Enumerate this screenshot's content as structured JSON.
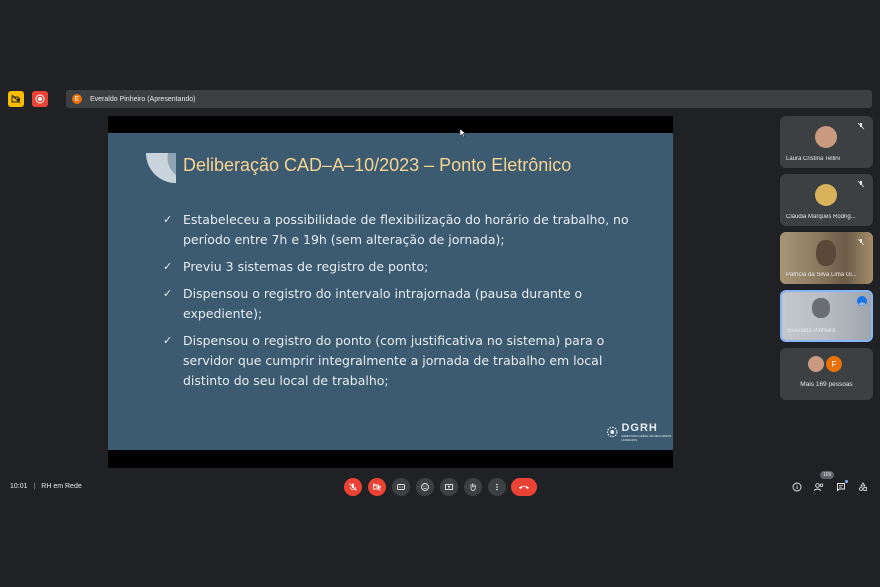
{
  "topbar": {
    "presenter_initial": "E",
    "presenter_label": "Everaldo Pinheiro (Apresentando)"
  },
  "slide": {
    "title": "Deliberação CAD–A–10/2023 – Ponto Eletrônico",
    "bullets": [
      "Estabeleceu a possibilidade de flexibilização do horário de trabalho, no período entre 7h e 19h (sem alteração de jornada);",
      "Previu 3 sistemas de registro de ponto;",
      "Dispensou o registro do intervalo intrajornada (pausa durante o expediente);",
      "Dispensou o registro do ponto (com justificativa no sistema) para o servidor que cumprir integralmente a jornada de trabalho em local distinto do seu local de trabalho;"
    ],
    "logo_text": "DGRH",
    "logo_sub": "DIRETORIA GERAL DE RECURSOS HUMANOS"
  },
  "participants": [
    {
      "name": "Laura Cristina Tellini"
    },
    {
      "name": "Cláudia Marques Rodrig..."
    },
    {
      "name": "Patrícia da Silva Lima Gi..."
    },
    {
      "name": "Everaldo Pinheiro"
    }
  ],
  "more_people": {
    "initial": "F",
    "label": "Mais 169 pessoas"
  },
  "bottombar": {
    "time": "10:01",
    "separator": "|",
    "meeting_name": "RH em Rede",
    "participant_count": "169"
  },
  "colors": {
    "background": "#202124",
    "slide_bg": "#3c5a70",
    "slide_title": "#f5d594",
    "danger": "#ea4335",
    "tile_bg": "#3c4043"
  }
}
